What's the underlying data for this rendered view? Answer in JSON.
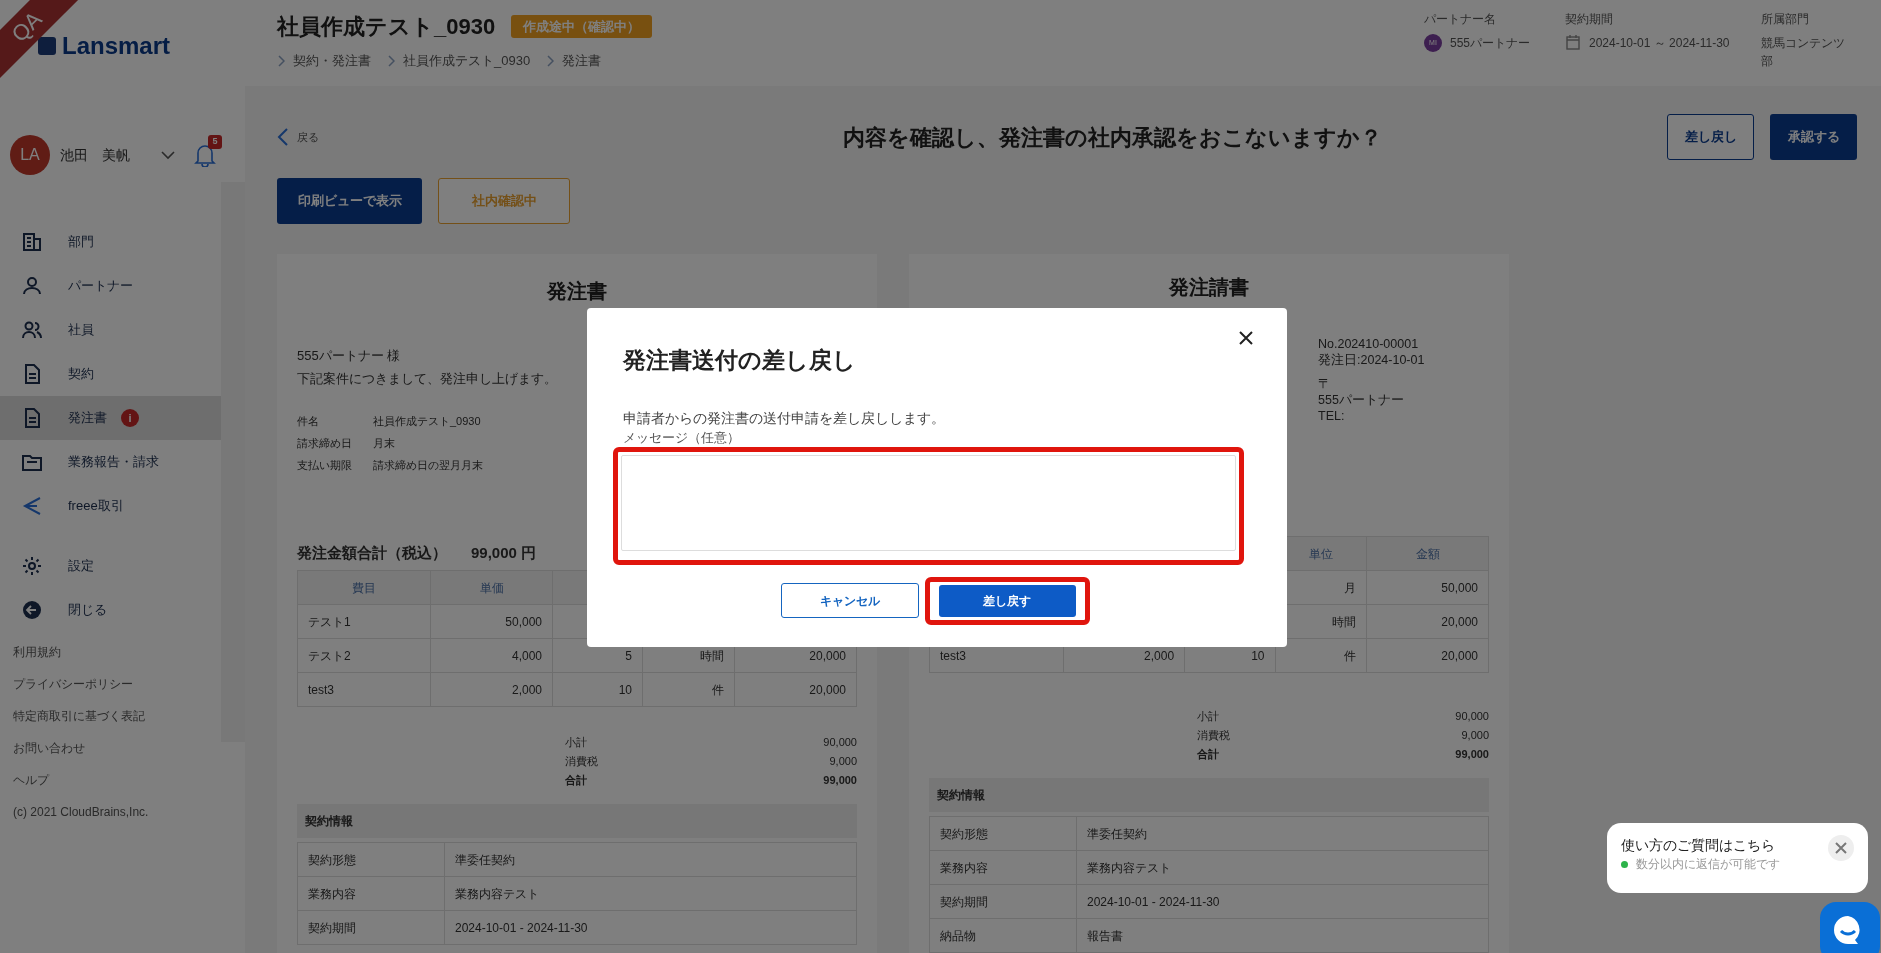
{
  "environment_ribbon": "QA",
  "sidebar": {
    "logo": "Lansmart",
    "user": {
      "initials": "LA",
      "name": "池田　美帆"
    },
    "notifications": "5",
    "items": [
      {
        "label": "部門",
        "selected": false
      },
      {
        "label": "パートナー",
        "selected": false
      },
      {
        "label": "社員",
        "selected": false
      },
      {
        "label": "契約",
        "selected": false
      },
      {
        "label": "発注書",
        "selected": true,
        "badge": "i"
      },
      {
        "label": "業務報告・請求",
        "selected": false
      },
      {
        "label": "freee取引",
        "selected": false
      }
    ],
    "bottom_items": [
      {
        "label": "設定"
      },
      {
        "label": "閉じる"
      }
    ],
    "links": [
      "利用規約",
      "プライバシーポリシー",
      "特定商取引に基づく表記",
      "お問い合わせ",
      "ヘルプ"
    ],
    "copyright": "(c) 2021 CloudBrains,Inc."
  },
  "header": {
    "title": "社員作成テスト_0930",
    "status": "作成途中（確認中）",
    "breadcrumbs": [
      "契約・発注書",
      "社員作成テスト_0930",
      "発注書"
    ],
    "info": [
      {
        "kind": "partner",
        "label": "パートナー名",
        "initials": "MI",
        "value": "555パートナー"
      },
      {
        "kind": "period",
        "label": "契約期間",
        "value": "2024-10-01 ～ 2024-11-30"
      },
      {
        "kind": "plain",
        "label": "所属部門",
        "value": "競馬コンテンツ部"
      }
    ]
  },
  "page": {
    "back": "戻る",
    "question": "内容を確認し、発注書の社内承認をおこないますか？",
    "reject_button": "差し戻し",
    "approve_button": "承認する",
    "print_button": "印刷ビューで表示",
    "status_button": "社内確認中"
  },
  "documents": [
    {
      "kind": "order",
      "title": "発注書",
      "recipient": "555パートナー 様",
      "intro": "下記案件につきまして、発注申し上げます。",
      "fields": [
        {
          "label": "件名",
          "value": "社員作成テスト_0930"
        },
        {
          "label": "請求締め日",
          "value": "月末"
        },
        {
          "label": "支払い期限",
          "value": "請求締め日の翌月月末"
        }
      ],
      "total_label": "発注金額合計（税込）",
      "total_value": "99,000 円",
      "table": {
        "columns": [
          "費目",
          "単価",
          null,
          null,
          null
        ],
        "rows": [
          [
            "テスト1",
            "50,000",
            null,
            null,
            null
          ],
          [
            "テスト2",
            "4,000",
            "5",
            "時間",
            "20,000"
          ],
          [
            "test3",
            "2,000",
            "10",
            "件",
            "20,000"
          ]
        ]
      },
      "summary": [
        {
          "label": "小計",
          "value": "90,000",
          "bold": false
        },
        {
          "label": "消費税",
          "value": "9,000",
          "bold": false
        },
        {
          "label": "合計",
          "value": "99,000",
          "bold": true
        }
      ],
      "contract": {
        "heading": "契約情報",
        "rows": [
          {
            "label": "契約形態",
            "value": "準委任契約"
          },
          {
            "label": "業務内容",
            "value": "業務内容テスト"
          },
          {
            "label": "契約期間",
            "value": "2024-10-01 - 2024-11-30"
          }
        ]
      }
    },
    {
      "kind": "acceptance",
      "title": "発注請書",
      "info": [
        "No.202410-00001",
        "発注日:2024-10-01",
        "〒",
        "555パートナー",
        "TEL:"
      ],
      "table": {
        "columns": [
          null,
          null,
          null,
          "単位",
          "金額"
        ],
        "rows": [
          [
            null,
            null,
            null,
            "月",
            "50,000"
          ],
          [
            null,
            null,
            null,
            "時間",
            "20,000"
          ],
          [
            "test3",
            "2,000",
            "10",
            "件",
            "20,000"
          ]
        ]
      },
      "summary": [
        {
          "label": "小計",
          "value": "90,000",
          "bold": false
        },
        {
          "label": "消費税",
          "value": "9,000",
          "bold": false
        },
        {
          "label": "合計",
          "value": "99,000",
          "bold": true
        }
      ],
      "contract": {
        "heading": "契約情報",
        "rows": [
          {
            "label": "契約形態",
            "value": "準委任契約"
          },
          {
            "label": "業務内容",
            "value": "業務内容テスト"
          },
          {
            "label": "契約期間",
            "value": "2024-10-01 - 2024-11-30"
          },
          {
            "label": "納品物",
            "value": "報告書"
          }
        ]
      }
    }
  ],
  "modal": {
    "title": "発注書送付の差し戻し",
    "description": "申請者からの発注書の送付申請を差し戻しします。",
    "field_label": "メッセージ（任意）",
    "field_highlighted": true,
    "cancel": "キャンセル",
    "submit": "差し戻す",
    "submit_highlighted": true
  },
  "chat": {
    "title": "使い方のご質問はこちら",
    "status": "数分以内に返信が可能です",
    "online": true
  }
}
